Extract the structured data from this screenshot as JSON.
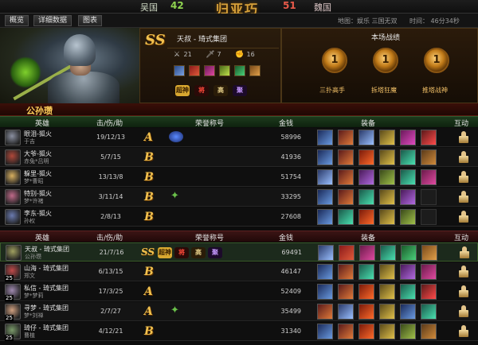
{
  "score": {
    "wu_name": "吴国",
    "wu_score": "42",
    "wei_score": "51",
    "wei_name": "魏国",
    "logo": "归亚巧"
  },
  "tabs": [
    "概览",
    "详细数据",
    "图表"
  ],
  "map": "地图：娱乐 三国无双",
  "time": "时间：  46分34秒",
  "banner": {
    "grade": "SS",
    "player": "天叔 - 琦式集团",
    "kills": "21",
    "deaths": "7",
    "assists": "16",
    "perf_title": "本场战绩",
    "medals": [
      {
        "label": "三扑高手",
        "rank": "1"
      },
      {
        "label": "拆塔狂魔",
        "rank": "1"
      },
      {
        "label": "推塔战神",
        "rank": "1"
      }
    ],
    "badges": [
      "超神",
      "将",
      "高",
      "聚"
    ],
    "items": [
      "sword",
      "flame",
      "potion",
      "gem",
      "leaf",
      "shoe"
    ]
  },
  "team_label": "公孙瓒",
  "headers": {
    "hero": "英雄",
    "kda": "击/伤/助",
    "honor": "荣誉称号",
    "money": "金钱",
    "equip": "装备",
    "interact": "互动"
  },
  "team1": [
    {
      "player": "眼泪-狐火",
      "hero": "于吉",
      "level": "",
      "kda": "19/12/13",
      "grade": "A",
      "money": "58996",
      "honor_icon": "orb",
      "equip": [
        "blade",
        "claw",
        "sword",
        "boot",
        "ring",
        "orb"
      ]
    },
    {
      "player": "大爷-狐火",
      "hero": "赤兔*吕明",
      "level": "",
      "kda": "5/7/15",
      "grade": "B",
      "money": "41936",
      "honor_icon": "",
      "equip": [
        "blade",
        "claw",
        "fire",
        "boot",
        "gem",
        "shield"
      ]
    },
    {
      "player": "躲里-狐火",
      "hero": "梦*曹昭",
      "level": "",
      "kda": "13/13/8",
      "grade": "B",
      "money": "51754",
      "honor_icon": "",
      "equip": [
        "sword",
        "claw",
        "axe",
        "armor",
        "gem",
        "potion"
      ]
    },
    {
      "player": "特别-狐火",
      "hero": "梦*许褚",
      "level": "",
      "kda": "3/11/14",
      "grade": "B",
      "money": "33295",
      "honor_icon": "star",
      "equip": [
        "blade",
        "claw",
        "gem",
        "boot",
        "axe",
        ""
      ]
    },
    {
      "player": "李东-狐火",
      "hero": "孙权",
      "level": "",
      "kda": "2/8/13",
      "grade": "B",
      "money": "27608",
      "honor_icon": "",
      "equip": [
        "blade",
        "gem",
        "fire",
        "boot",
        "armor",
        ""
      ]
    }
  ],
  "team2": [
    {
      "player": "天叔 - 琦式集团",
      "hero": "公孙瓒",
      "level": "",
      "kda": "21/7/16",
      "grade": "SS",
      "money": "69491",
      "honor_icon": "badges",
      "equip": [
        "sword",
        "flame",
        "potion",
        "gem",
        "leaf",
        "shoe"
      ]
    },
    {
      "player": "山海 - 琦式集团",
      "hero": "郑文",
      "level": "25",
      "kda": "6/13/15",
      "grade": "B",
      "money": "46147",
      "honor_icon": "",
      "equip": [
        "blade",
        "claw",
        "gem",
        "boot",
        "axe",
        "potion"
      ]
    },
    {
      "player": "私信 - 琦式集团",
      "hero": "梦*梦莉",
      "level": "25",
      "kda": "17/3/25",
      "grade": "A",
      "money": "52409",
      "honor_icon": "",
      "equip": [
        "blade",
        "claw",
        "fire",
        "boot",
        "gem",
        "orb"
      ]
    },
    {
      "player": "寻梦 - 琦式集团",
      "hero": "梦*刘禅",
      "level": "25",
      "kda": "2/7/27",
      "grade": "A",
      "money": "35499",
      "honor_icon": "star",
      "equip": [
        "claw",
        "sword",
        "fire",
        "boot",
        "blade",
        "gem"
      ]
    },
    {
      "player": "琦仔 - 琦式集团",
      "hero": "曹植",
      "level": "25",
      "kda": "4/12/21",
      "grade": "B",
      "money": "31340",
      "honor_icon": "",
      "equip": [
        "blade",
        "claw",
        "fire",
        "boot",
        "armor",
        "shield"
      ]
    }
  ],
  "colors": {
    "wu": "#8fd34f",
    "wei": "#e85a4a",
    "gold": "#f2c14e",
    "team_label": "#ffcf5a"
  }
}
